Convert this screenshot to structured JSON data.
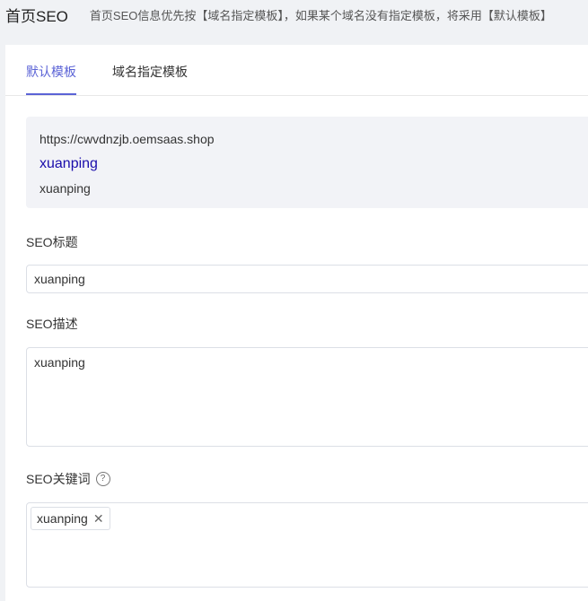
{
  "header": {
    "title": "首页SEO",
    "hint": "首页SEO信息优先按【域名指定模板】，如果某个域名没有指定模板，将采用【默认模板】"
  },
  "tabs": [
    {
      "label": "默认模板",
      "active": true
    },
    {
      "label": "域名指定模板",
      "active": false
    }
  ],
  "preview": {
    "url": "https://cwvdnzjb.oemsaas.shop",
    "title": "xuanping",
    "description": "xuanping"
  },
  "form": {
    "seo_title": {
      "label": "SEO标题",
      "value": "xuanping"
    },
    "seo_description": {
      "label": "SEO描述",
      "value": "xuanping"
    },
    "seo_keywords": {
      "label": "SEO关键词",
      "help_icon": "question-circle-icon",
      "tags": [
        {
          "label": "xuanping",
          "close_icon": "close-icon"
        }
      ]
    }
  },
  "colors": {
    "accent": "#5b63d6",
    "preview_title": "#1a0dab",
    "preview_bg": "#f2f3f7",
    "page_bg": "#f0f2f5"
  }
}
